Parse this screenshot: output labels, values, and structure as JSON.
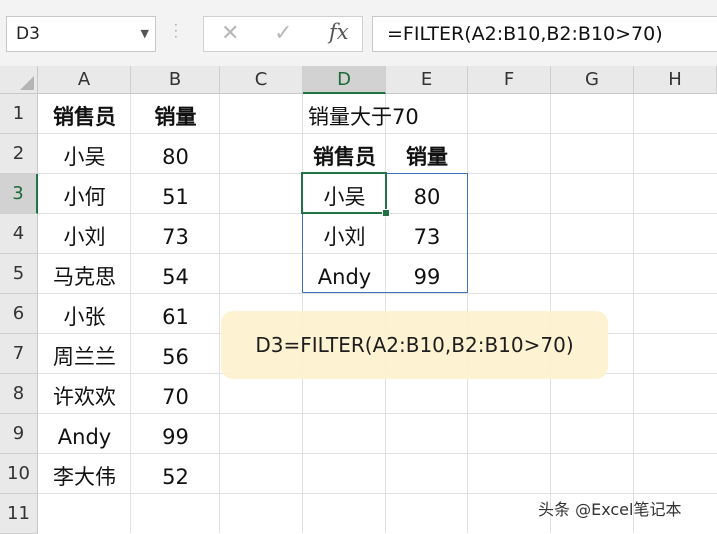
{
  "formula_bar": {
    "name_box": "D3",
    "cancel_icon": "✕",
    "enter_icon": "✓",
    "fx_label": "fx",
    "formula": "=FILTER(A2:B10,B2:B10>70)"
  },
  "columns": [
    "A",
    "B",
    "C",
    "D",
    "E",
    "F",
    "G",
    "H"
  ],
  "rows": [
    "1",
    "2",
    "3",
    "4",
    "5",
    "6",
    "7",
    "8",
    "9",
    "10",
    "11"
  ],
  "source_table": {
    "headers": [
      "销售员",
      "销量"
    ],
    "rows": [
      [
        "小吴",
        "80"
      ],
      [
        "小何",
        "51"
      ],
      [
        "小刘",
        "73"
      ],
      [
        "马克思",
        "54"
      ],
      [
        "小张",
        "61"
      ],
      [
        "周兰兰",
        "56"
      ],
      [
        "许欢欢",
        "70"
      ],
      [
        "Andy",
        "99"
      ],
      [
        "李大伟",
        "52"
      ]
    ]
  },
  "filter_title": "销量大于70",
  "result_table": {
    "headers": [
      "销售员",
      "销量"
    ],
    "rows": [
      [
        "小吴",
        "80"
      ],
      [
        "小刘",
        "73"
      ],
      [
        "Andy",
        "99"
      ]
    ]
  },
  "note": "D3=FILTER(A2:B10,B2:B10>70)",
  "watermark": "头条 @Excel笔记本",
  "colors": {
    "active_green": "#217346",
    "result_border": "#3f72c0",
    "note_fill": "#fdf2cf"
  }
}
